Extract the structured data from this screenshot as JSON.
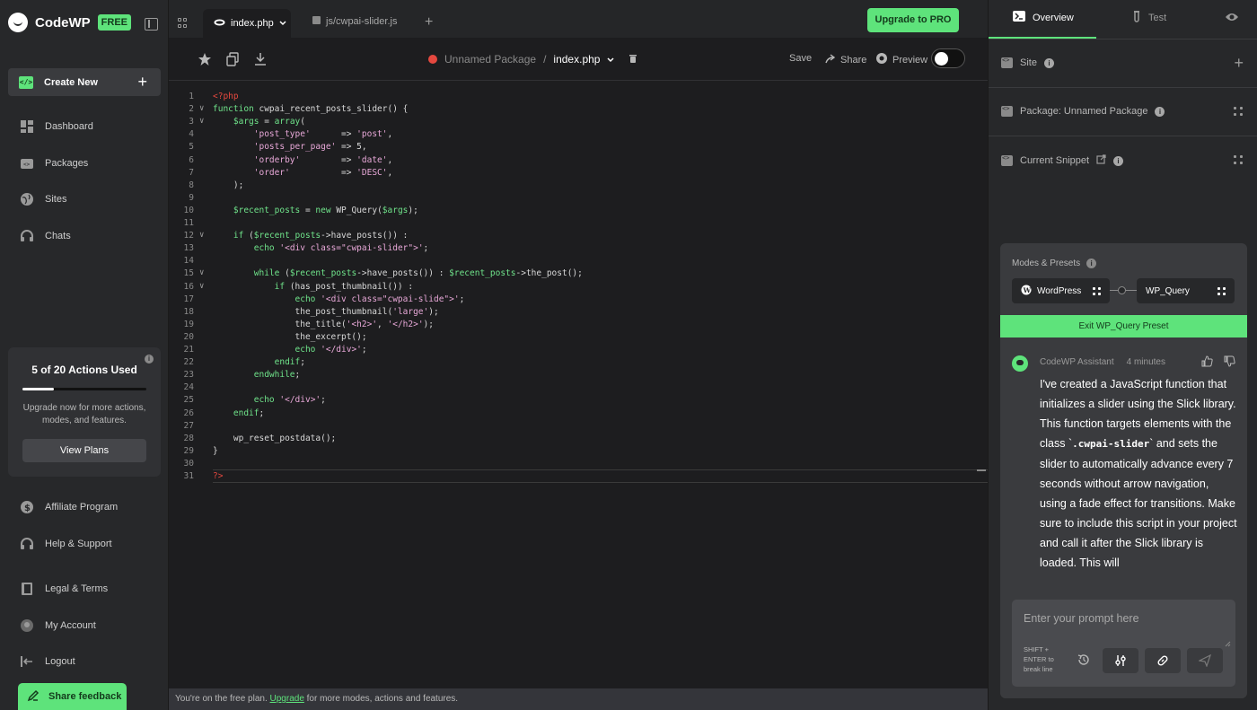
{
  "sidebar": {
    "brand": "CodeWP",
    "badge": "FREE",
    "create_new": "Create New",
    "nav": [
      "Dashboard",
      "Packages",
      "Sites",
      "Chats"
    ],
    "actions_card": {
      "title": "5 of 20 Actions Used",
      "used": 5,
      "total": 20,
      "text": "Upgrade now for more actions, modes, and features.",
      "button": "View Plans"
    },
    "bottom_nav": [
      "Affiliate Program",
      "Help & Support",
      "Legal & Terms",
      "My Account",
      "Logout"
    ],
    "share_feedback": "Share feedback"
  },
  "tabs": {
    "active": "index.php",
    "inactive": "js/cwpai-slider.js",
    "upgrade": "Upgrade to PRO"
  },
  "toolbar": {
    "package_name": "Unnamed Package",
    "separator": "/",
    "file_name": "index.php",
    "save": "Save",
    "share": "Share",
    "preview": "Preview"
  },
  "code": {
    "lines": [
      "<?php",
      "function cwpai_recent_posts_slider() {",
      "    $args = array(",
      "        'post_type'      => 'post',",
      "        'posts_per_page' => 5,",
      "        'orderby'        => 'date',",
      "        'order'          => 'DESC',",
      "    );",
      "",
      "    $recent_posts = new WP_Query($args);",
      "",
      "    if ($recent_posts->have_posts()) :",
      "        echo '<div class=\"cwpai-slider\">';",
      "",
      "        while ($recent_posts->have_posts()) : $recent_posts->the_post();",
      "            if (has_post_thumbnail()) :",
      "                echo '<div class=\"cwpai-slide\">';",
      "                the_post_thumbnail('large');",
      "                the_title('<h2>', '</h2>');",
      "                the_excerpt();",
      "                echo '</div>';",
      "            endif;",
      "        endwhile;",
      "",
      "        echo '</div>';",
      "    endif;",
      "",
      "    wp_reset_postdata();",
      "}",
      "",
      "?>"
    ],
    "folded_lines": [
      2,
      3,
      12,
      15,
      16
    ]
  },
  "status_bar": {
    "before": "You're on the free plan. ",
    "link": "Upgrade",
    "after": " for more modes, actions and features."
  },
  "right_panel": {
    "tabs": [
      "Overview",
      "Test"
    ],
    "sections": [
      "Site",
      "Package: Unnamed Package",
      "Current Snippet"
    ],
    "modes_label": "Modes & Presets",
    "presets": [
      "WordPress",
      "WP_Query"
    ],
    "exit_preset": "Exit WP_Query Preset",
    "message": {
      "author": "CodeWP Assistant",
      "time": "4 minutes",
      "text_before": "I've created a JavaScript function that initializes a slider using the Slick library. This function targets elements with the class `",
      "code": ".cwpai-slider",
      "text_after": "` and sets the slider to automatically advance every 7 seconds without arrow navigation, using a fade effect for transitions. Make sure to include this script in your project and call it after the Slick library is loaded. This will"
    },
    "prompt_placeholder": "Enter your prompt here",
    "prompt_hint": "SHIFT + ENTER to break line"
  },
  "colors": {
    "accent": "#5ee37b",
    "error": "#e5483f"
  }
}
